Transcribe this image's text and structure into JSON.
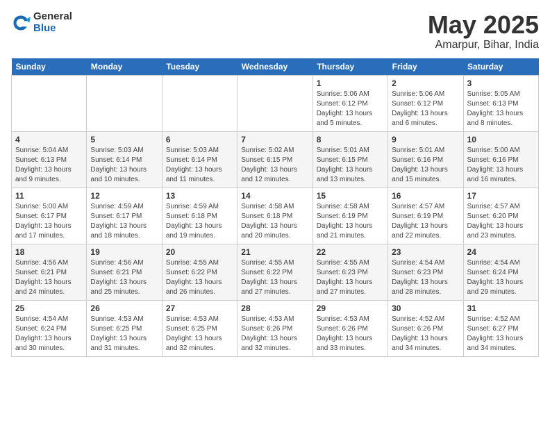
{
  "logo": {
    "general": "General",
    "blue": "Blue"
  },
  "title": "May 2025",
  "subtitle": "Amarpur, Bihar, India",
  "days_of_week": [
    "Sunday",
    "Monday",
    "Tuesday",
    "Wednesday",
    "Thursday",
    "Friday",
    "Saturday"
  ],
  "weeks": [
    [
      {
        "day": "",
        "info": ""
      },
      {
        "day": "",
        "info": ""
      },
      {
        "day": "",
        "info": ""
      },
      {
        "day": "",
        "info": ""
      },
      {
        "day": "1",
        "info": "Sunrise: 5:06 AM\nSunset: 6:12 PM\nDaylight: 13 hours and 5 minutes."
      },
      {
        "day": "2",
        "info": "Sunrise: 5:06 AM\nSunset: 6:12 PM\nDaylight: 13 hours and 6 minutes."
      },
      {
        "day": "3",
        "info": "Sunrise: 5:05 AM\nSunset: 6:13 PM\nDaylight: 13 hours and 8 minutes."
      }
    ],
    [
      {
        "day": "4",
        "info": "Sunrise: 5:04 AM\nSunset: 6:13 PM\nDaylight: 13 hours and 9 minutes."
      },
      {
        "day": "5",
        "info": "Sunrise: 5:03 AM\nSunset: 6:14 PM\nDaylight: 13 hours and 10 minutes."
      },
      {
        "day": "6",
        "info": "Sunrise: 5:03 AM\nSunset: 6:14 PM\nDaylight: 13 hours and 11 minutes."
      },
      {
        "day": "7",
        "info": "Sunrise: 5:02 AM\nSunset: 6:15 PM\nDaylight: 13 hours and 12 minutes."
      },
      {
        "day": "8",
        "info": "Sunrise: 5:01 AM\nSunset: 6:15 PM\nDaylight: 13 hours and 13 minutes."
      },
      {
        "day": "9",
        "info": "Sunrise: 5:01 AM\nSunset: 6:16 PM\nDaylight: 13 hours and 15 minutes."
      },
      {
        "day": "10",
        "info": "Sunrise: 5:00 AM\nSunset: 6:16 PM\nDaylight: 13 hours and 16 minutes."
      }
    ],
    [
      {
        "day": "11",
        "info": "Sunrise: 5:00 AM\nSunset: 6:17 PM\nDaylight: 13 hours and 17 minutes."
      },
      {
        "day": "12",
        "info": "Sunrise: 4:59 AM\nSunset: 6:17 PM\nDaylight: 13 hours and 18 minutes."
      },
      {
        "day": "13",
        "info": "Sunrise: 4:59 AM\nSunset: 6:18 PM\nDaylight: 13 hours and 19 minutes."
      },
      {
        "day": "14",
        "info": "Sunrise: 4:58 AM\nSunset: 6:18 PM\nDaylight: 13 hours and 20 minutes."
      },
      {
        "day": "15",
        "info": "Sunrise: 4:58 AM\nSunset: 6:19 PM\nDaylight: 13 hours and 21 minutes."
      },
      {
        "day": "16",
        "info": "Sunrise: 4:57 AM\nSunset: 6:19 PM\nDaylight: 13 hours and 22 minutes."
      },
      {
        "day": "17",
        "info": "Sunrise: 4:57 AM\nSunset: 6:20 PM\nDaylight: 13 hours and 23 minutes."
      }
    ],
    [
      {
        "day": "18",
        "info": "Sunrise: 4:56 AM\nSunset: 6:21 PM\nDaylight: 13 hours and 24 minutes."
      },
      {
        "day": "19",
        "info": "Sunrise: 4:56 AM\nSunset: 6:21 PM\nDaylight: 13 hours and 25 minutes."
      },
      {
        "day": "20",
        "info": "Sunrise: 4:55 AM\nSunset: 6:22 PM\nDaylight: 13 hours and 26 minutes."
      },
      {
        "day": "21",
        "info": "Sunrise: 4:55 AM\nSunset: 6:22 PM\nDaylight: 13 hours and 27 minutes."
      },
      {
        "day": "22",
        "info": "Sunrise: 4:55 AM\nSunset: 6:23 PM\nDaylight: 13 hours and 27 minutes."
      },
      {
        "day": "23",
        "info": "Sunrise: 4:54 AM\nSunset: 6:23 PM\nDaylight: 13 hours and 28 minutes."
      },
      {
        "day": "24",
        "info": "Sunrise: 4:54 AM\nSunset: 6:24 PM\nDaylight: 13 hours and 29 minutes."
      }
    ],
    [
      {
        "day": "25",
        "info": "Sunrise: 4:54 AM\nSunset: 6:24 PM\nDaylight: 13 hours and 30 minutes."
      },
      {
        "day": "26",
        "info": "Sunrise: 4:53 AM\nSunset: 6:25 PM\nDaylight: 13 hours and 31 minutes."
      },
      {
        "day": "27",
        "info": "Sunrise: 4:53 AM\nSunset: 6:25 PM\nDaylight: 13 hours and 32 minutes."
      },
      {
        "day": "28",
        "info": "Sunrise: 4:53 AM\nSunset: 6:26 PM\nDaylight: 13 hours and 32 minutes."
      },
      {
        "day": "29",
        "info": "Sunrise: 4:53 AM\nSunset: 6:26 PM\nDaylight: 13 hours and 33 minutes."
      },
      {
        "day": "30",
        "info": "Sunrise: 4:52 AM\nSunset: 6:26 PM\nDaylight: 13 hours and 34 minutes."
      },
      {
        "day": "31",
        "info": "Sunrise: 4:52 AM\nSunset: 6:27 PM\nDaylight: 13 hours and 34 minutes."
      }
    ]
  ]
}
